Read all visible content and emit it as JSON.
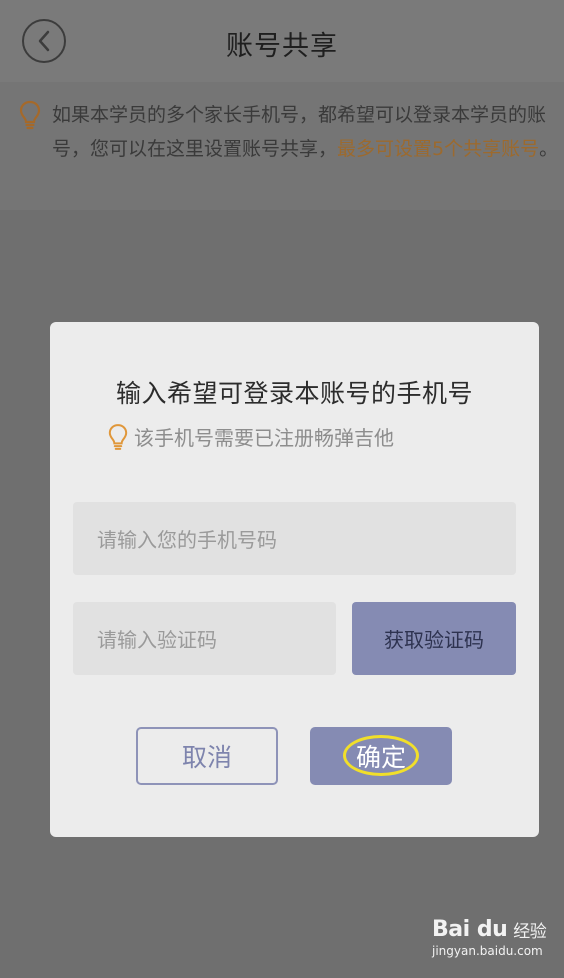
{
  "header": {
    "title": "账号共享",
    "back_icon": "chevron-left-icon"
  },
  "notice": {
    "icon": "lightbulb-icon",
    "text_before": "如果本学员的多个家长手机号，都希望可以登录本学员的账号，您可以在这里设置账号共享，",
    "text_highlight": "最多可设置5个共享账号",
    "text_after": "。",
    "highlight_color": "#9c6a2e"
  },
  "dialog": {
    "title": "输入希望可登录本账号的手机号",
    "hint": "该手机号需要已注册畅弹吉他",
    "hint_icon": "lightbulb-icon",
    "phone_placeholder": "请输入您的手机号码",
    "code_placeholder": "请输入验证码",
    "get_code_label": "获取验证码",
    "cancel_label": "取消",
    "confirm_label": "确定",
    "accent_color": "#858bb3"
  },
  "watermark": {
    "brand": "Bai du",
    "brand_cn": "经验",
    "site": "jingyan.baidu.com"
  }
}
